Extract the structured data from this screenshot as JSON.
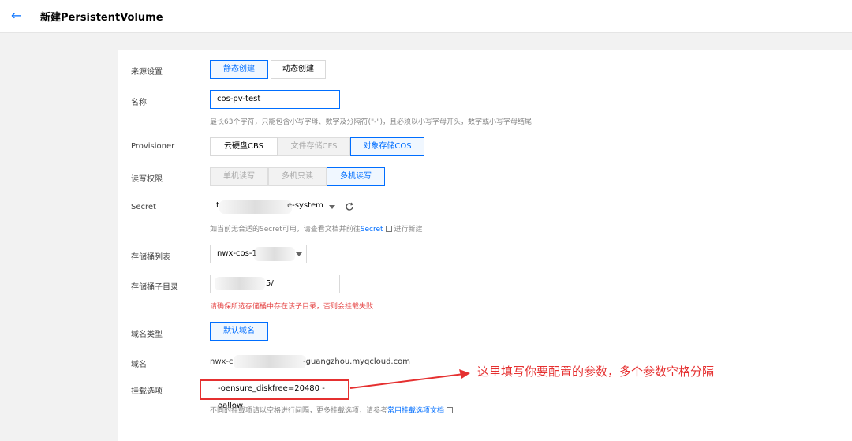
{
  "header": {
    "title": "新建PersistentVolume"
  },
  "form": {
    "source": {
      "label": "来源设置",
      "options": [
        "静态创建",
        "动态创建"
      ]
    },
    "name": {
      "label": "名称",
      "value": "cos-pv-test",
      "hint": "最长63个字符，只能包含小写字母、数字及分隔符(\"-\")，且必须以小写字母开头，数字或小写字母结尾"
    },
    "provisioner": {
      "label": "Provisioner",
      "options": [
        "云硬盘CBS",
        "文件存储CFS",
        "对象存储COS"
      ]
    },
    "access": {
      "label": "读写权限",
      "options": [
        "单机读写",
        "多机只读",
        "多机读写"
      ]
    },
    "secret": {
      "label": "Secret",
      "value_prefix": "t",
      "value_suffix": "e-system",
      "hint_pre": "如当前无合适的Secret可用，请查看文档并前往",
      "hint_link": "Secret",
      "hint_post": "进行新建"
    },
    "bucket": {
      "label": "存储桶列表",
      "value": "nwx-cos-1"
    },
    "subdir": {
      "label": "存储桶子目录",
      "value": "5/",
      "hint": "请确保所选存储桶中存在该子目录，否则会挂载失败"
    },
    "domain_type": {
      "label": "域名类型",
      "button": "默认域名"
    },
    "domain": {
      "label": "域名",
      "value_prefix": "nwx-c",
      "value_suffix": "-guangzhou.myqcloud.com"
    },
    "mount": {
      "label": "挂载选项",
      "value": "-oensure_diskfree=20480 -oallow",
      "hint_pre": "不同的挂载项请以空格进行间隔，更多挂载选项，请参考",
      "hint_link": "常用挂载选项文档"
    }
  },
  "annotation": {
    "text": "这里填写你要配置的参数，多个参数空格分隔"
  },
  "colors": {
    "accent": "#006eff",
    "error": "#e54545",
    "annotation": "#e53030"
  }
}
